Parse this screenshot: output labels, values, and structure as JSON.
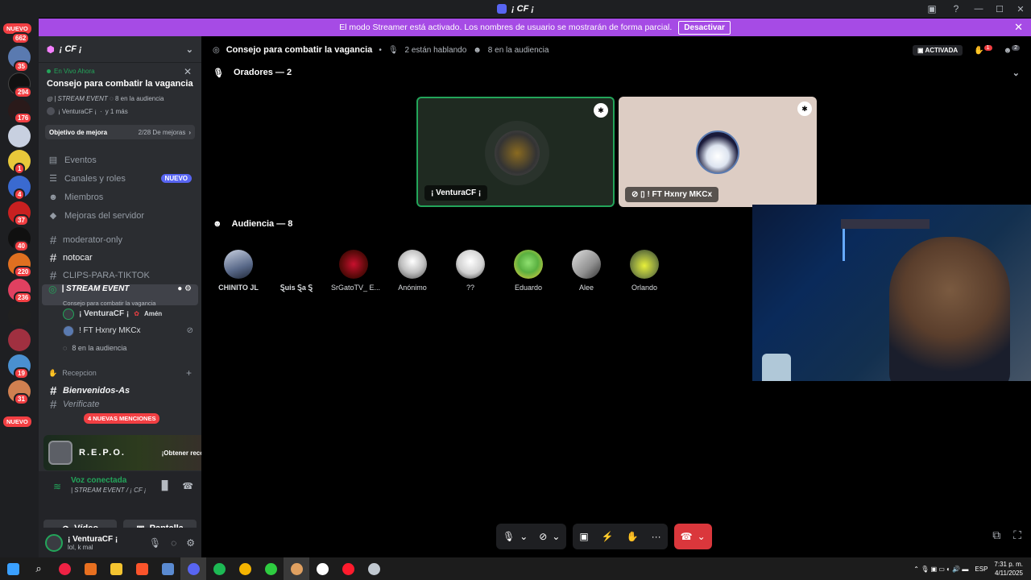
{
  "window": {
    "title": "¡ CF ¡"
  },
  "banner": {
    "text": "El modo Streamer está activado. Los nombres de usuario se mostrarán de forma parcial.",
    "button": "Desactivar"
  },
  "servers": {
    "top_new": "NUEVO",
    "top_count": "662",
    "bottom_new": "NUEVO",
    "badges": [
      "35",
      "294",
      "176",
      "1",
      "4",
      "37",
      "40",
      "220",
      "236",
      "19",
      "31"
    ]
  },
  "sidebar": {
    "server_name": "¡ CF ¡",
    "live": {
      "tag": "En Vivo Ahora",
      "title": "Consejo para combatir la vagancia",
      "channel": "| STREAM EVENT",
      "audience": "8 en la audiencia",
      "host": "¡ VenturaCF ¡",
      "more": "y 1 más"
    },
    "goal": {
      "label": "Objetivo de mejora",
      "progress": "2/28 De mejoras"
    },
    "menu": [
      {
        "label": "Eventos"
      },
      {
        "label": "Canales y roles",
        "badge": "NUEVO"
      },
      {
        "label": "Miembros"
      },
      {
        "label": "Mejoras del servidor"
      }
    ],
    "channels": [
      "moderator-only",
      "notocar",
      "CLIPS-PARA-TIKTOK"
    ],
    "active_channel": {
      "name": "| STREAM EVENT",
      "topic": "Consejo para combatir la vagancia"
    },
    "voice_users": [
      {
        "name": "¡ VenturaCF ¡",
        "tag": "Amén"
      },
      {
        "name": "! FT Hxnry MKCx"
      }
    ],
    "audience_line": "8 en la audiencia",
    "category": "Recepcion",
    "lower_channels": [
      "Bienvenidos-As",
      "Verificate"
    ],
    "mentions": "4 NUEVAS MENCIONES",
    "promo": {
      "title": "R.E.P.O.",
      "button": "¡Obtener recompensa!"
    },
    "voice": {
      "status": "Voz conectada",
      "sub": "| STREAM EVENT / ¡ CF ¡",
      "video": "Vídeo",
      "screen": "Pantalla"
    },
    "user": {
      "name": "¡ VenturaCF ¡",
      "status": "lol, k mal"
    }
  },
  "main": {
    "topbar": {
      "title": "Consejo para combatir la vagancia",
      "speaking": "2 están hablando",
      "audience": "8 en la audiencia",
      "pill": "ACTIVADA",
      "notif": "1",
      "notif2": "2"
    },
    "speakers_title": "Oradores — 2",
    "speakers": [
      {
        "name": "¡ VenturaCF ¡"
      },
      {
        "name": "! FT Hxnry MKCx"
      }
    ],
    "audience_title": "Audiencia — 8",
    "audience": [
      {
        "name": "CHINITO JL",
        "color": "#8a95a8"
      },
      {
        "name": "Ȿuis Ȿa Ȿ",
        "color": "#000000"
      },
      {
        "name": "SrGatoTV_ E...",
        "color": "#5a0a0a"
      },
      {
        "name": "Anónimo",
        "color": "#d8d8d8"
      },
      {
        "name": "??",
        "color": "#c8c8c8"
      },
      {
        "name": "Eduardo",
        "color": "#6fc64a"
      },
      {
        "name": "Alee",
        "color": "#b8b8b8"
      },
      {
        "name": "Orlando",
        "color": "#7a9a3a"
      }
    ]
  },
  "taskbar": {
    "lang": "ESP",
    "time": "7:31 p. m.",
    "date": "4/11/2025"
  }
}
